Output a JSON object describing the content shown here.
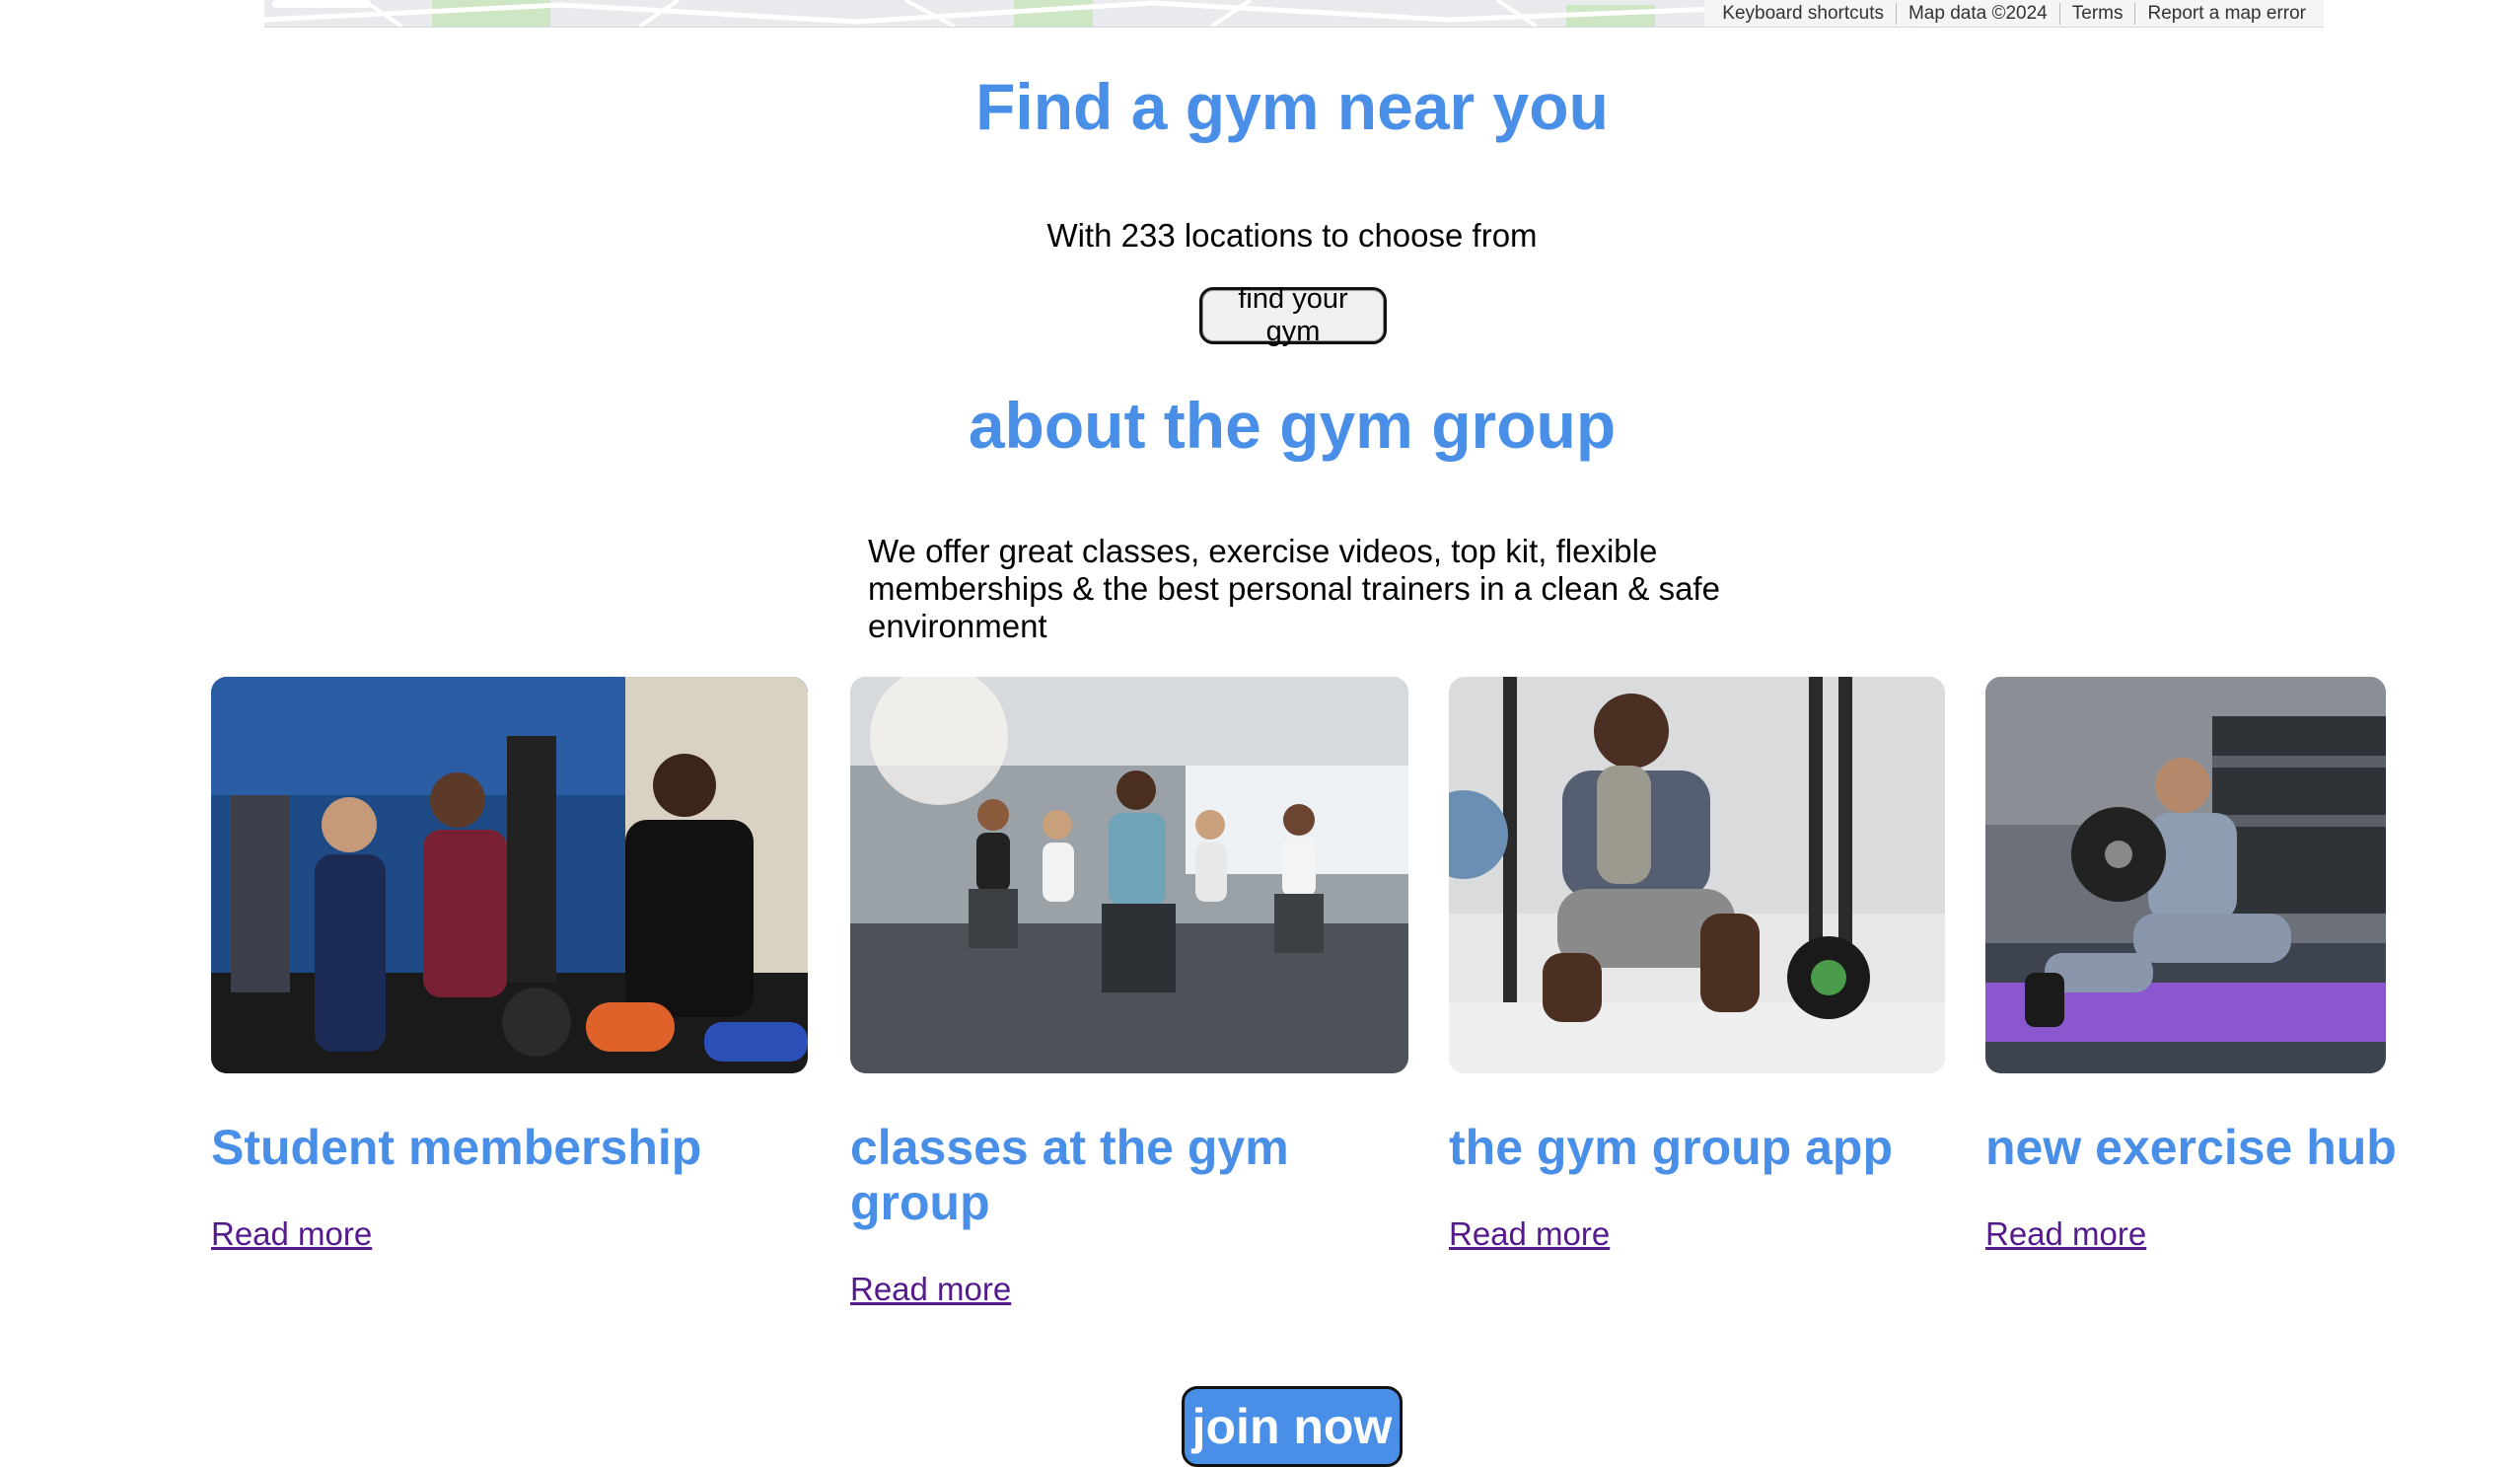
{
  "map": {
    "attribution": [
      "Keyboard shortcuts",
      "Map data ©2024",
      "Terms",
      "Report a map error"
    ]
  },
  "hero": {
    "title": "Find a gym near you",
    "subtitle": "With 233 locations to choose from",
    "button_label": "find your gym"
  },
  "about": {
    "title": "about the gym group",
    "text": "We offer great classes, exercise videos, top kit, flexible memberships & the best personal trainers in a clean & safe environment"
  },
  "cards": [
    {
      "title": "Student membership",
      "link": "Read more",
      "image": "students-training-photo"
    },
    {
      "title": "classes at the gym group",
      "link": "Read more",
      "image": "group-class-lunges-photo"
    },
    {
      "title": "the gym group app",
      "link": "Read more",
      "image": "man-using-phone-photo"
    },
    {
      "title": "new exercise hub",
      "link": "Read more",
      "image": "man-weight-plate-photo"
    }
  ],
  "cta": {
    "label": "join now"
  },
  "colors": {
    "accent": "#4a8fe7",
    "link": "#551a8b"
  }
}
